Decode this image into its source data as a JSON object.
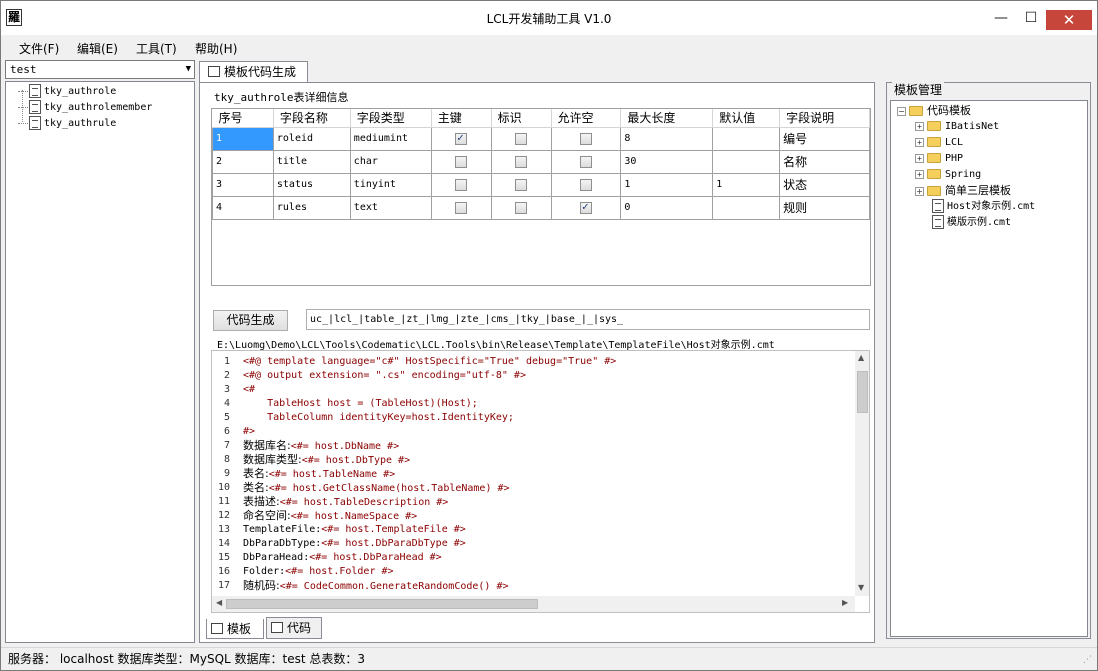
{
  "window": {
    "title": "LCL开发辅助工具 V1.0",
    "icon_glyph": "羅",
    "min_glyph": "—",
    "max_glyph": "☐",
    "close_glyph": "✕"
  },
  "menu": [
    "文件(F)",
    "编辑(E)",
    "工具(T)",
    "帮助(H)"
  ],
  "left": {
    "database_selected": "test",
    "tables": [
      "tky_authrole",
      "tky_authrolemember",
      "tky_authrule"
    ]
  },
  "tabs": {
    "main": "模板代码生成"
  },
  "table_detail": {
    "title": "tky_authrole表详细信息",
    "columns": [
      "序号",
      "字段名称",
      "字段类型",
      "主键",
      "标识",
      "允许空",
      "最大长度",
      "默认值",
      "字段说明"
    ],
    "rows": [
      {
        "no": "1",
        "name": "roleid",
        "type": "mediumint",
        "pk": true,
        "identity": false,
        "nullable": false,
        "maxlen": "8",
        "default": "",
        "desc": "编号"
      },
      {
        "no": "2",
        "name": "title",
        "type": "char",
        "pk": false,
        "identity": false,
        "nullable": false,
        "maxlen": "30",
        "default": "",
        "desc": "名称"
      },
      {
        "no": "3",
        "name": "status",
        "type": "tinyint",
        "pk": false,
        "identity": false,
        "nullable": false,
        "maxlen": "1",
        "default": "1",
        "desc": "状态"
      },
      {
        "no": "4",
        "name": "rules",
        "type": "text",
        "pk": false,
        "identity": false,
        "nullable": true,
        "maxlen": "0",
        "default": "",
        "desc": "规则"
      }
    ]
  },
  "generator": {
    "button_label": "代码生成",
    "prefix_value": "uc_|lcl_|table_|zt_|lmg_|zte_|cms_|tky_|base_|_|sys_",
    "template_path": "E:\\Luomg\\Demo\\LCL\\Tools\\Codematic\\LCL.Tools\\bin\\Release\\Template\\TemplateFile\\Host对象示例.cmt"
  },
  "code_lines": [
    {
      "n": "1",
      "parts": [
        {
          "t": "<#@ template language=\"c#\" HostSpecific=\"True\" debug=\"True\" #>",
          "c": "d"
        }
      ]
    },
    {
      "n": "2",
      "parts": [
        {
          "t": "<#@ output extension= \".cs\" encoding=\"utf-8\" #>",
          "c": "d"
        }
      ]
    },
    {
      "n": "3",
      "parts": [
        {
          "t": "<#",
          "c": "d"
        }
      ]
    },
    {
      "n": "4",
      "parts": [
        {
          "t": "    TableHost host = (TableHost)(Host);",
          "c": "d"
        }
      ]
    },
    {
      "n": "5",
      "parts": [
        {
          "t": "    TableColumn identityKey=host.IdentityKey;",
          "c": "d"
        }
      ]
    },
    {
      "n": "6",
      "parts": [
        {
          "t": "#>",
          "c": "d"
        }
      ]
    },
    {
      "n": "7",
      "parts": [
        {
          "t": "数据库名:",
          "c": "h"
        },
        {
          "t": "<#= host.DbName #>",
          "c": "d"
        }
      ]
    },
    {
      "n": "8",
      "parts": [
        {
          "t": "数据库类型:",
          "c": "h"
        },
        {
          "t": "<#= host.DbType #>",
          "c": "d"
        }
      ]
    },
    {
      "n": "9",
      "parts": [
        {
          "t": "表名:",
          "c": "h"
        },
        {
          "t": "<#= host.TableName #>",
          "c": "d"
        }
      ]
    },
    {
      "n": "10",
      "parts": [
        {
          "t": "类名:",
          "c": "h"
        },
        {
          "t": "<#= host.GetClassName(host.TableName) #>",
          "c": "d"
        }
      ]
    },
    {
      "n": "11",
      "parts": [
        {
          "t": "表描述:",
          "c": "h"
        },
        {
          "t": "<#= host.TableDescription #>",
          "c": "d"
        }
      ]
    },
    {
      "n": "12",
      "parts": [
        {
          "t": "命名空间:",
          "c": "h"
        },
        {
          "t": "<#= host.NameSpace #>",
          "c": "d"
        }
      ]
    },
    {
      "n": "13",
      "parts": [
        {
          "t": "TemplateFile:",
          "c": "k"
        },
        {
          "t": "<#= host.TemplateFile #>",
          "c": "d"
        }
      ]
    },
    {
      "n": "14",
      "parts": [
        {
          "t": "DbParaDbType:",
          "c": "k"
        },
        {
          "t": "<#= host.DbParaDbType #>",
          "c": "d"
        }
      ]
    },
    {
      "n": "15",
      "parts": [
        {
          "t": "DbParaHead:",
          "c": "k"
        },
        {
          "t": "<#= host.DbParaHead #>",
          "c": "d"
        }
      ]
    },
    {
      "n": "16",
      "parts": [
        {
          "t": "Folder:",
          "c": "k"
        },
        {
          "t": "<#= host.Folder #>",
          "c": "d"
        }
      ]
    },
    {
      "n": "17",
      "parts": [
        {
          "t": "随机码:",
          "c": "h"
        },
        {
          "t": "<#= CodeCommon.GenerateRandomCode() #>",
          "c": "d"
        }
      ]
    }
  ],
  "bottom_tabs": [
    "模板",
    "代码"
  ],
  "template_manager": {
    "title": "模板管理",
    "root": "代码模板",
    "folders": [
      "IBatisNet",
      "LCL",
      "PHP",
      "Spring",
      "简单三层模板"
    ],
    "files": [
      "Host对象示例.cmt",
      "模版示例.cmt"
    ]
  },
  "status": {
    "text": "服务器： localhost 数据库类型：MySQL 数据库：test 总表数：3"
  }
}
